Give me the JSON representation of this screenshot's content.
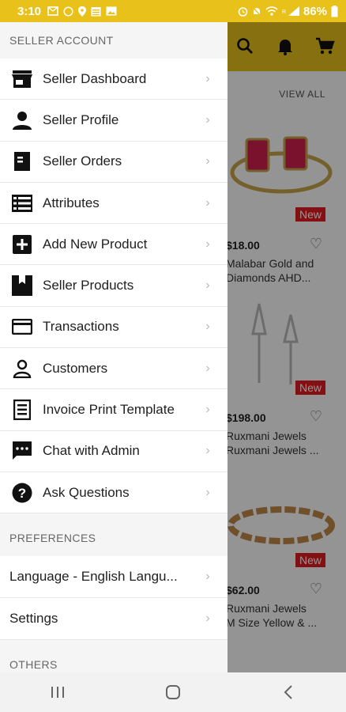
{
  "status_bar": {
    "time": "3:10",
    "battery": "86%",
    "left_icons": [
      "mail-icon",
      "whatsapp-icon",
      "location-icon",
      "calendar-icon",
      "gallery-icon"
    ],
    "right_icons": [
      "alarm-icon",
      "mute-icon",
      "wifi-icon",
      "signal-icon",
      "battery-icon"
    ]
  },
  "background": {
    "view_all": "VIEW ALL",
    "products": [
      {
        "price": "$18.00",
        "name_line1": "Malabar Gold and",
        "name_line2": "Diamonds AHD...",
        "badge": "New"
      },
      {
        "price": "$198.00",
        "name_line1": "Ruxmani Jewels",
        "name_line2": "Ruxmani Jewels ...",
        "badge": "New"
      },
      {
        "price": "$62.00",
        "name_line1": "Ruxmani Jewels",
        "name_line2": "M Size Yellow & ...",
        "badge": "New"
      }
    ]
  },
  "drawer": {
    "seller_header": "SELLER ACCOUNT",
    "seller_items": [
      {
        "label": "Seller Dashboard",
        "icon": "store-icon"
      },
      {
        "label": "Seller Profile",
        "icon": "person-icon"
      },
      {
        "label": "Seller Orders",
        "icon": "orders-icon"
      },
      {
        "label": "Attributes",
        "icon": "list-icon"
      },
      {
        "label": "Add New Product",
        "icon": "add-box-icon"
      },
      {
        "label": "Seller Products",
        "icon": "bookmark-box-icon"
      },
      {
        "label": "Transactions",
        "icon": "credit-card-icon"
      },
      {
        "label": "Customers",
        "icon": "person-outline-icon"
      },
      {
        "label": "Invoice Print Template",
        "icon": "receipt-icon"
      },
      {
        "label": "Chat with Admin",
        "icon": "chat-icon"
      },
      {
        "label": "Ask Questions",
        "icon": "help-icon"
      }
    ],
    "preferences_header": "PREFERENCES",
    "preference_items": [
      {
        "label": "Language - English Langu..."
      },
      {
        "label": "Settings"
      }
    ],
    "others_header": "OTHERS"
  },
  "colors": {
    "accent": "#e8c21a",
    "badge": "#e31c23"
  }
}
